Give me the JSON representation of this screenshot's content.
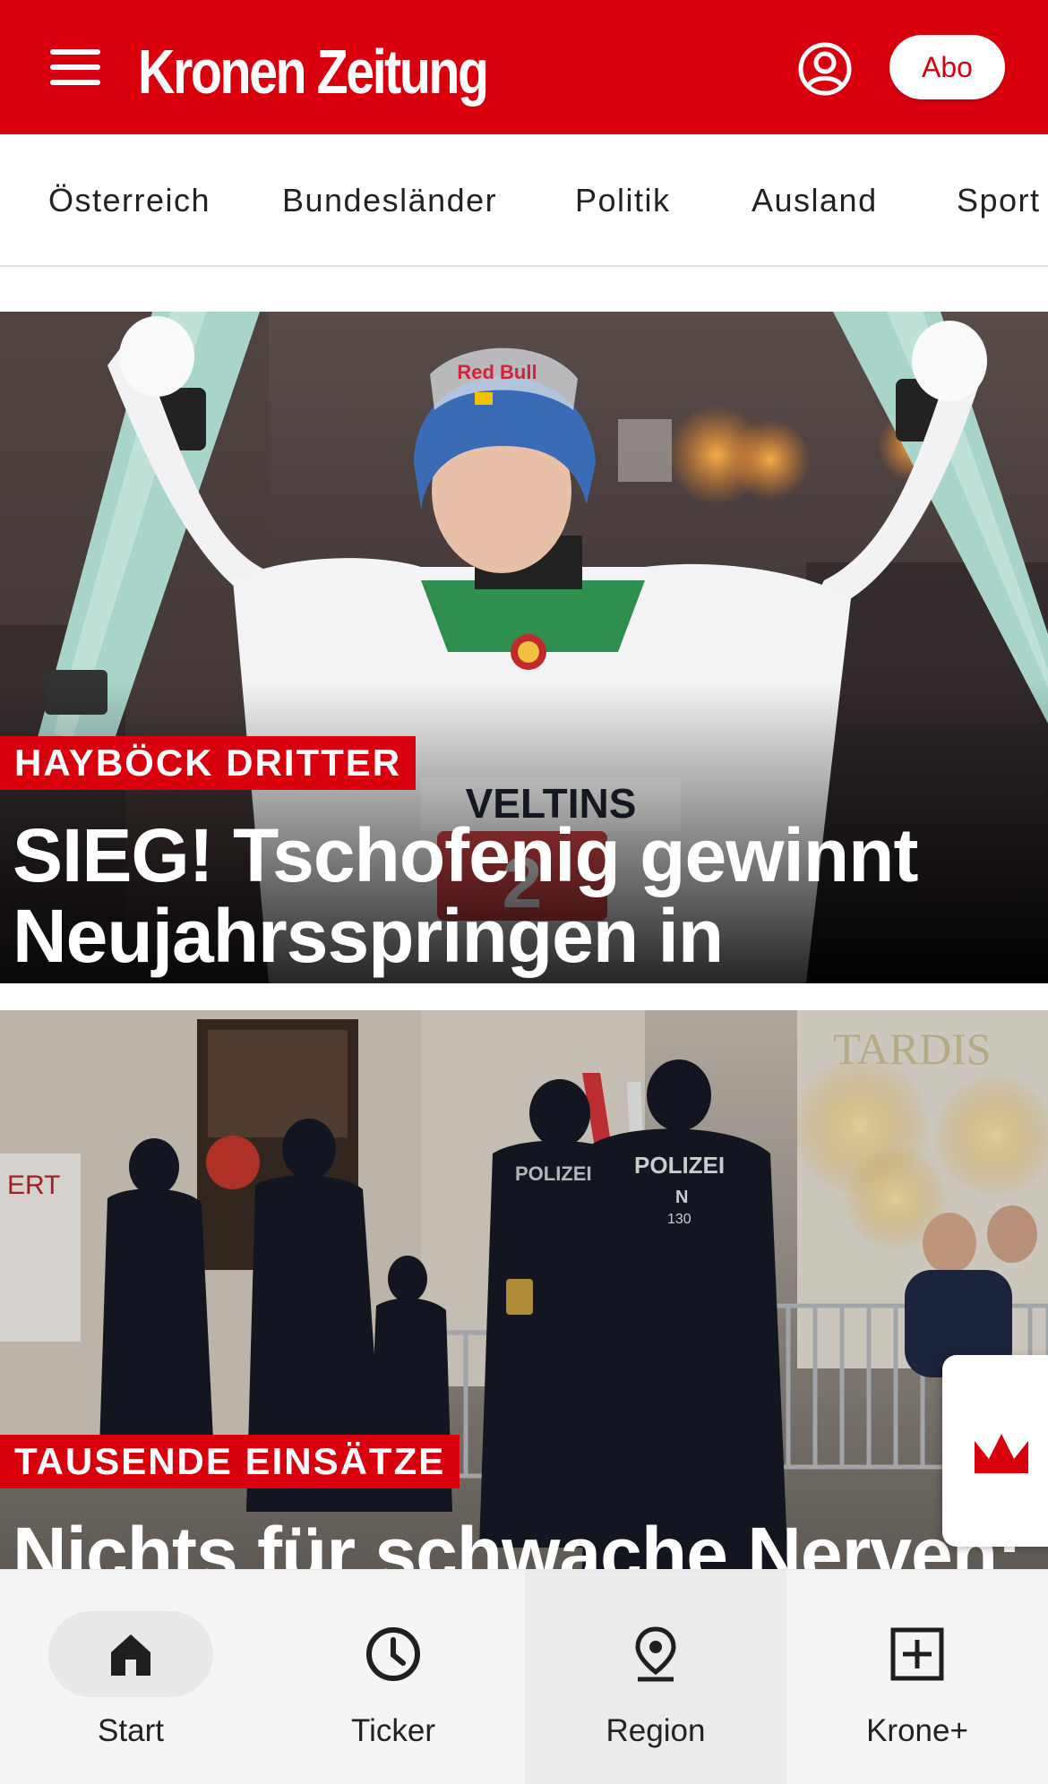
{
  "header": {
    "logo_text": "Kronen Zeitung",
    "abo_label": "Abo",
    "brand_color": "#d9000d"
  },
  "nav": {
    "items": [
      "Österreich",
      "Bundesländer",
      "Politik",
      "Ausland",
      "Sport"
    ]
  },
  "articles": [
    {
      "kicker": "HAYBÖCK DRITTER",
      "headline": "SIEG! Tschofenig gewinnt Neujahrsspringen in Garmisch",
      "image_alt_text": [
        "Red Bull",
        "VELTINS",
        "2"
      ]
    },
    {
      "kicker": "TAUSENDE EINSÄTZE",
      "headline": "Nichts für schwache Nerven:",
      "image_alt_text": [
        "POLIZEI",
        "N",
        "130"
      ]
    }
  ],
  "bottom_nav": {
    "tabs": [
      {
        "label": "Start",
        "icon": "home-icon"
      },
      {
        "label": "Ticker",
        "icon": "clock-icon"
      },
      {
        "label": "Region",
        "icon": "location-pin-icon"
      },
      {
        "label": "Krone+",
        "icon": "plus-square-icon"
      }
    ]
  }
}
